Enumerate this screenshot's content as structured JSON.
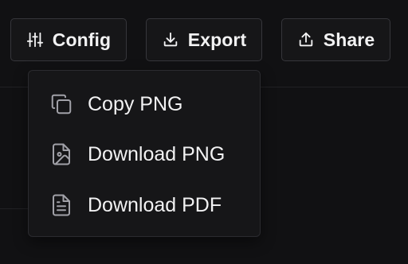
{
  "toolbar": {
    "config": {
      "label": "Config",
      "icon": "sliders-icon"
    },
    "export": {
      "label": "Export",
      "icon": "download-icon"
    },
    "share": {
      "label": "Share",
      "icon": "share-upload-icon"
    }
  },
  "export_menu": {
    "items": [
      {
        "label": "Copy PNG",
        "icon": "copy-icon"
      },
      {
        "label": "Download PNG",
        "icon": "image-file-icon"
      },
      {
        "label": "Download PDF",
        "icon": "document-file-icon"
      }
    ]
  },
  "colors": {
    "background": "#111113",
    "surface": "#161618",
    "border": "#36363b",
    "text": "#f2f2f3",
    "icon_muted": "#a1a1a8"
  }
}
